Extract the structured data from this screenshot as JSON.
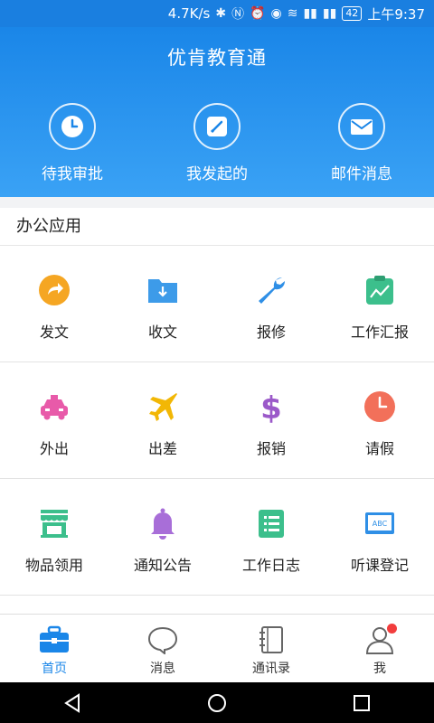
{
  "status_bar": {
    "speed": "4.7K/s",
    "battery": "42",
    "time": "上午9:37"
  },
  "header": {
    "title": "优肯教育通",
    "quick_actions": [
      {
        "label": "待我审批",
        "icon": "clock-icon"
      },
      {
        "label": "我发起的",
        "icon": "edit-icon"
      },
      {
        "label": "邮件消息",
        "icon": "mail-icon"
      }
    ]
  },
  "section": {
    "title": "办公应用"
  },
  "apps": [
    {
      "label": "发文",
      "icon": "send-doc-icon",
      "color": "#f5a623"
    },
    {
      "label": "收文",
      "icon": "receive-folder-icon",
      "color": "#3d9be9"
    },
    {
      "label": "报修",
      "icon": "wrench-icon",
      "color": "#2f8fe6"
    },
    {
      "label": "工作汇报",
      "icon": "report-clipboard-icon",
      "color": "#3cbf8c"
    },
    {
      "label": "外出",
      "icon": "taxi-icon",
      "color": "#e85aa9"
    },
    {
      "label": "出差",
      "icon": "airplane-icon",
      "color": "#f2b705"
    },
    {
      "label": "报销",
      "icon": "dollar-icon",
      "color": "#9b59c9"
    },
    {
      "label": "请假",
      "icon": "clock-icon",
      "color": "#f2705a"
    },
    {
      "label": "物品领用",
      "icon": "store-icon",
      "color": "#3cbf8c"
    },
    {
      "label": "通知公告",
      "icon": "bell-icon",
      "color": "#a86ed8"
    },
    {
      "label": "工作日志",
      "icon": "log-list-icon",
      "color": "#3cbf8c"
    },
    {
      "label": "听课登记",
      "icon": "blackboard-icon",
      "color": "#2f8fe6"
    }
  ],
  "tabs": [
    {
      "label": "首页",
      "icon": "briefcase-icon",
      "active": true
    },
    {
      "label": "消息",
      "icon": "chat-bubble-icon",
      "active": false
    },
    {
      "label": "通讯录",
      "icon": "address-book-icon",
      "active": false
    },
    {
      "label": "我",
      "icon": "person-icon",
      "active": false
    }
  ],
  "colors": {
    "primary": "#1a86e8",
    "badge": "#f23d3d"
  }
}
